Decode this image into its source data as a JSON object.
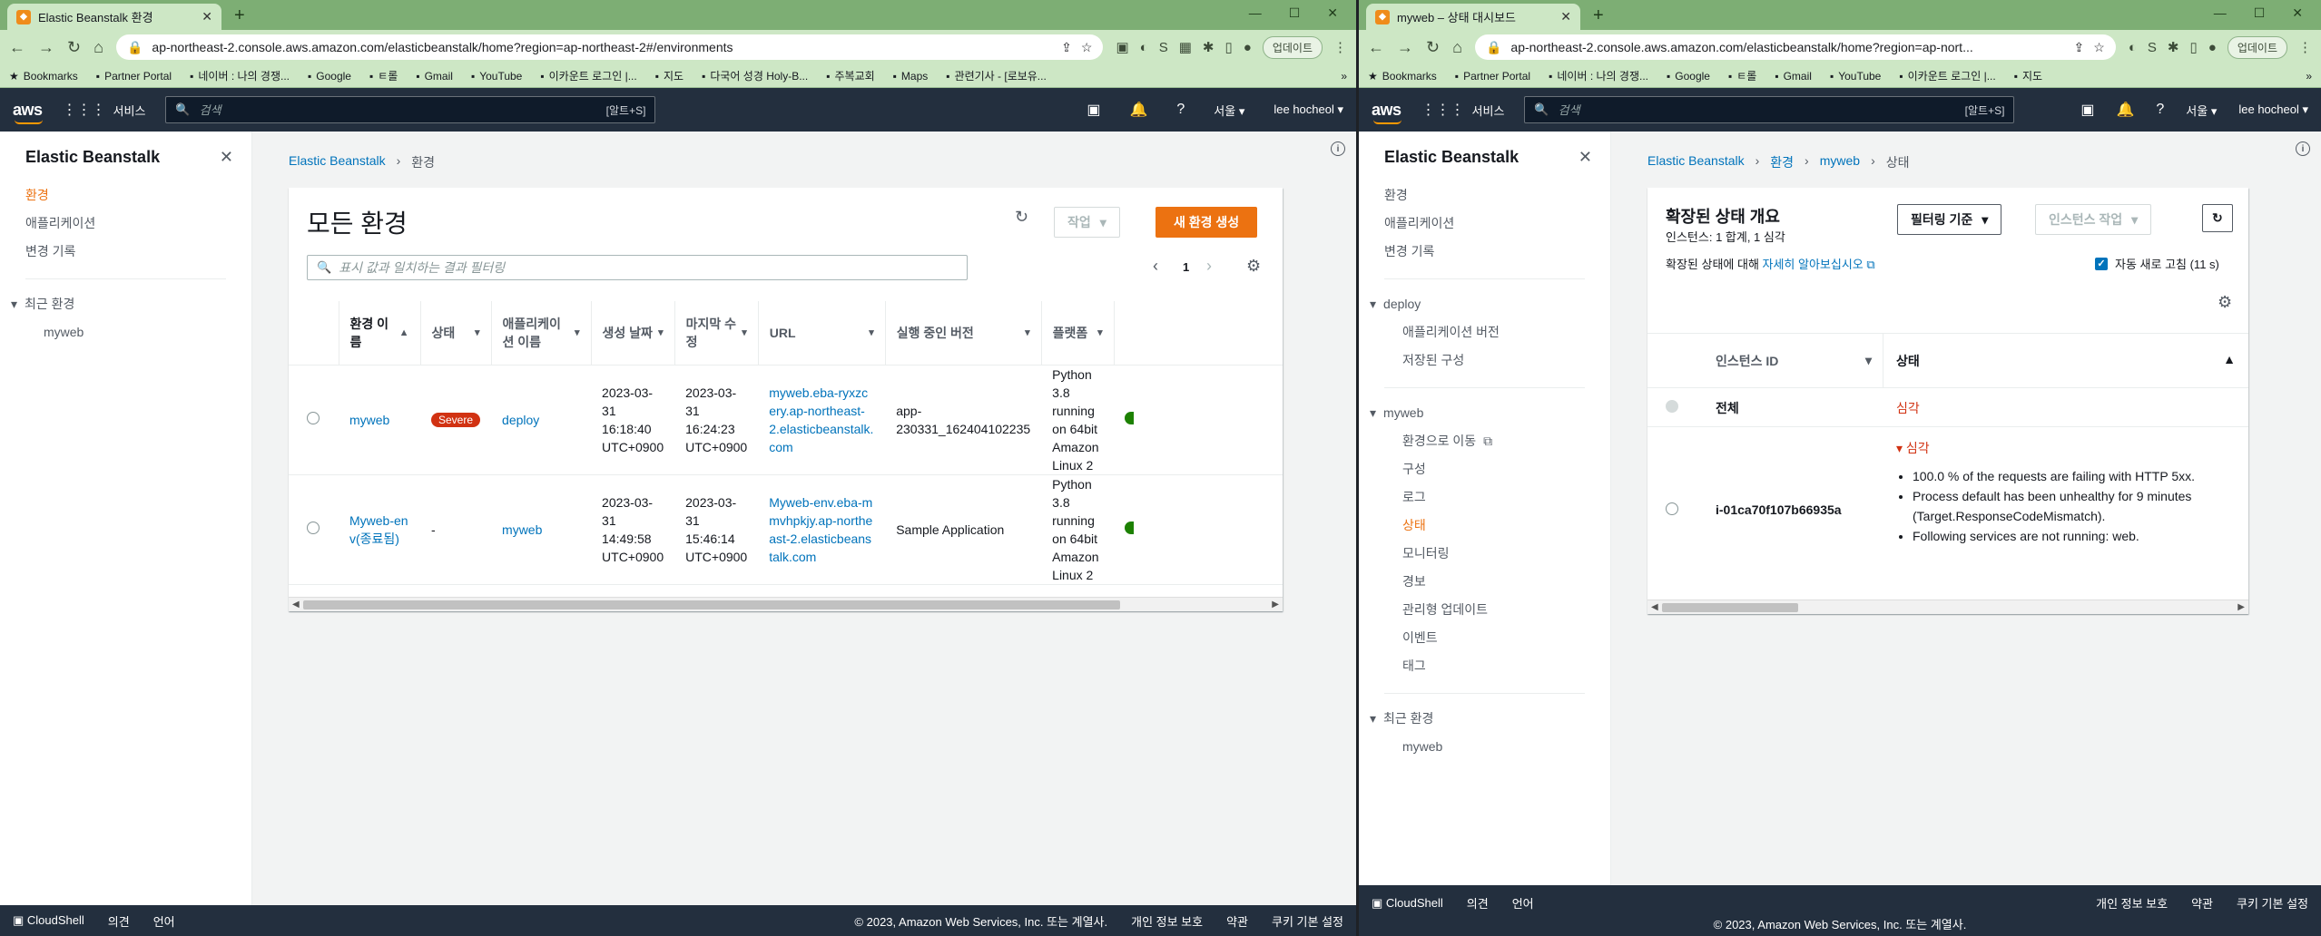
{
  "left": {
    "tab_title": "Elastic Beanstalk 환경",
    "url": "ap-northeast-2.console.aws.amazon.com/elasticbeanstalk/home?region=ap-northeast-2#/environments",
    "update_label": "업데이트",
    "bookmarks": [
      "Bookmarks",
      "Partner Portal",
      "네이버 : 나의 경쟁...",
      "Google",
      "ㅌ롤",
      "Gmail",
      "YouTube",
      "이카운트 로그인 |...",
      "지도",
      "다국어 성경 Holy-B...",
      "주복교회",
      "Maps",
      "관련기사 - [로보유..."
    ],
    "aws": {
      "services": "서비스",
      "search_placeholder": "검색",
      "shortcut": "[알트+S]",
      "region": "서울 ▾",
      "user": "lee hocheol ▾"
    },
    "sidebar": {
      "title": "Elastic Beanstalk",
      "items": [
        "환경",
        "애플리케이션",
        "변경 기록"
      ],
      "recent_title": "최근 환경",
      "recent_items": [
        "myweb"
      ]
    },
    "breadcrumb": [
      "Elastic Beanstalk",
      "환경"
    ],
    "panel": {
      "title": "모든 환경",
      "actions_label": "작업",
      "create_label": "새 환경 생성",
      "filter_placeholder": "표시 값과 일치하는 결과 필터링",
      "page": "1",
      "columns": [
        "환경 이름",
        "상태",
        "애플리케이션 이름",
        "생성 날짜",
        "마지막 수정",
        "URL",
        "실행 중인 버전",
        "플랫폼"
      ],
      "rows": [
        {
          "name": "myweb",
          "status": "Severe",
          "app": "deploy",
          "created": "2023-03-31 16:18:40 UTC+0900",
          "modified": "2023-03-31 16:24:23 UTC+0900",
          "url": "myweb.eba-ryxzcery.ap-northeast-2.elasticbeanstalk.com",
          "version": "app-230331_162404102235",
          "platform": "Python 3.8 running on 64bit Amazon Linux 2"
        },
        {
          "name": "Myweb-env(종료됨)",
          "status": "-",
          "app": "myweb",
          "created": "2023-03-31 14:49:58 UTC+0900",
          "modified": "2023-03-31 15:46:14 UTC+0900",
          "url": "Myweb-env.eba-mmvhpkjy.ap-northeast-2.elasticbeanstalk.com",
          "version": "Sample Application",
          "platform": "Python 3.8 running on 64bit Amazon Linux 2"
        }
      ]
    },
    "footer": {
      "cloudshell": "CloudShell",
      "feedback": "의견",
      "language": "언어",
      "copyright": "© 2023, Amazon Web Services, Inc. 또는 계열사.",
      "privacy": "개인 정보 보호",
      "terms": "약관",
      "cookies": "쿠키 기본 설정"
    }
  },
  "right": {
    "tab_title": "myweb – 상태 대시보드",
    "url": "ap-northeast-2.console.aws.amazon.com/elasticbeanstalk/home?region=ap-nort...",
    "update_label": "업데이트",
    "bookmarks": [
      "Bookmarks",
      "Partner Portal",
      "네이버 : 나의 경쟁...",
      "Google",
      "ㅌ롤",
      "Gmail",
      "YouTube",
      "이카운트 로그인 |...",
      "지도"
    ],
    "aws": {
      "services": "서비스",
      "search_placeholder": "검색",
      "shortcut": "[알트+S]",
      "region": "서울 ▾",
      "user": "lee hocheol ▾"
    },
    "sidebar": {
      "title": "Elastic Beanstalk",
      "items": [
        "환경",
        "애플리케이션",
        "변경 기록"
      ],
      "deploy_title": "deploy",
      "deploy_items": [
        "애플리케이션 버전",
        "저장된 구성"
      ],
      "myweb_title": "myweb",
      "myweb_items": [
        "환경으로 이동",
        "구성",
        "로그",
        "상태",
        "모니터링",
        "경보",
        "관리형 업데이트",
        "이벤트",
        "태그"
      ],
      "recent_title": "최근 환경",
      "recent_items": [
        "myweb"
      ]
    },
    "breadcrumb": [
      "Elastic Beanstalk",
      "환경",
      "myweb",
      "상태"
    ],
    "panel": {
      "title": "확장된 상태 개요",
      "subtitle": "인스턴스: 1 합계, 1 심각",
      "learn_prefix": "확장된 상태에 대해 ",
      "learn_link": "자세히 알아보십시오",
      "filter_label": "필터링 기준",
      "instance_action_label": "인스턴스 작업",
      "auto_refresh": "자동 새로 고침 (11 s)",
      "col_instance": "인스턴스 ID",
      "col_status": "상태",
      "all_label": "전체",
      "all_status": "심각",
      "instance_id": "i-01ca70f107b66935a",
      "instance_status": "심각",
      "causes": [
        "100.0 % of the requests are failing with HTTP 5xx.",
        "Process default has been unhealthy for 9 minutes (Target.ResponseCodeMismatch).",
        "Following services are not running: web."
      ]
    },
    "footer": {
      "cloudshell": "CloudShell",
      "feedback": "의견",
      "language": "언어",
      "copyright": "© 2023, Amazon Web Services, Inc. 또는 계열사.",
      "privacy": "개인 정보 보호",
      "terms": "약관",
      "cookies": "쿠키 기본 설정"
    }
  },
  "colors": {
    "aws_nav": "#232f3e",
    "accent": "#ec7211",
    "link": "#0073bb",
    "severe": "#d13212",
    "tabstrip": "#7dae74"
  }
}
